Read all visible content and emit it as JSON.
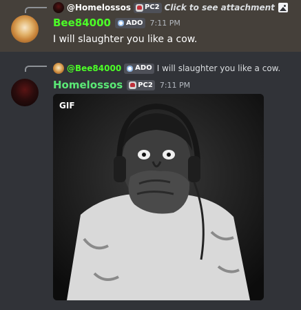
{
  "messages": [
    {
      "reply": {
        "name": "@Homelossos",
        "name_color": "#ffffff",
        "tag": "PC2",
        "tag_icon": "pc2-icon",
        "text": "Click to see attachment",
        "attachment_icon": "image-icon"
      },
      "author": {
        "name": "Bee84000",
        "name_color": "#4cff27",
        "tag": "ADO",
        "tag_icon": "ado-icon"
      },
      "time": "7:11 PM",
      "text": "I will slaughter you like a cow."
    },
    {
      "reply": {
        "name": "@Bee84000",
        "name_color": "#4cff27",
        "tag": "ADO",
        "tag_icon": "ado-icon",
        "text": "I will slaughter you like a cow."
      },
      "author": {
        "name": "Homelossos",
        "name_color": "#5bea76",
        "tag": "PC2",
        "tag_icon": "pc2-icon"
      },
      "time": "7:11 PM",
      "attachment": {
        "badge": "GIF",
        "subject": "man-with-headphones-covering-mouth"
      }
    }
  ],
  "colors": {
    "highlight_bg": "#45403a",
    "chat_bg": "#313338"
  }
}
